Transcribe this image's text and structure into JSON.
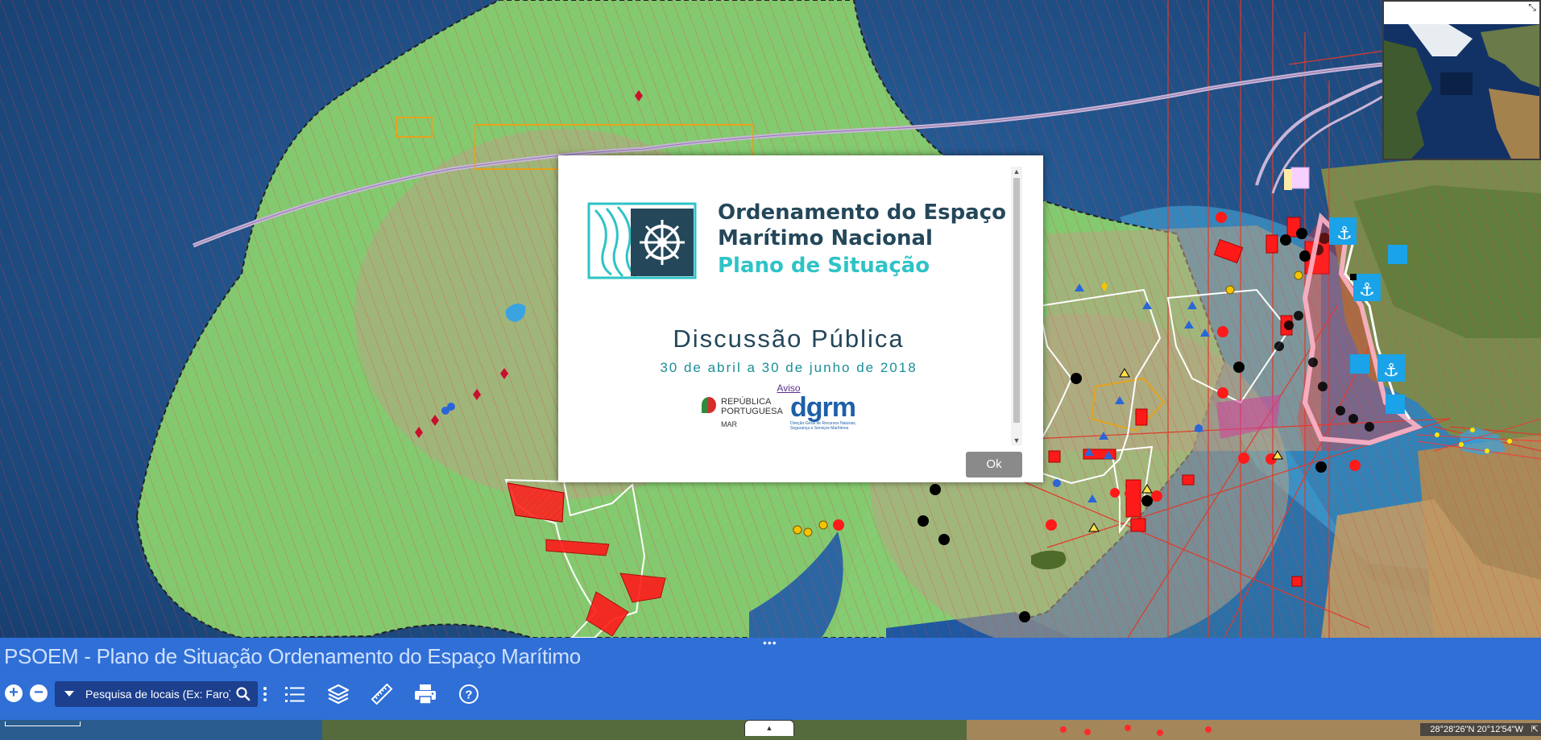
{
  "app": {
    "title": "PSOEM - Plano de Situação Ordenamento do Espaço Marítimo"
  },
  "modal": {
    "title_line1": "Ordenamento do Espaço",
    "title_line2": "Marítimo Nacional",
    "title_line3": "Plano de Situação",
    "heading": "Discussão Pública",
    "dates": "30 de abril a 30 de junho de 2018",
    "notice_link": "Aviso",
    "republic_logo": {
      "line1": "REPÚBLICA",
      "line2": "PORTUGUESA",
      "line3": "MAR"
    },
    "dgrm_logo": {
      "word": "dgrm",
      "subtitle": "Direção-Geral de Recursos Naturais, Segurança e Serviços Marítimos"
    },
    "ok_label": "Ok"
  },
  "toolbar": {
    "search_placeholder": "Pesquisa de locais (Ex: Faro)",
    "zoom_in_label": "+",
    "zoom_out_label": "−",
    "icons": [
      "zoom-in-icon",
      "zoom-out-icon",
      "dropdown-caret-icon",
      "search-icon",
      "more-vertical-icon",
      "list-icon",
      "layers-icon",
      "ruler-icon",
      "print-icon",
      "help-icon"
    ]
  },
  "status": {
    "coordinates": "28°28'26\"N 20°12'54\"W"
  },
  "colors": {
    "toolbar_bg": "#2f6fd6",
    "ocean": "#1f4f86",
    "eez_green": "#8dd46e",
    "accent_teal": "#2fc3c6",
    "ok_button": "#8a8a8a"
  }
}
